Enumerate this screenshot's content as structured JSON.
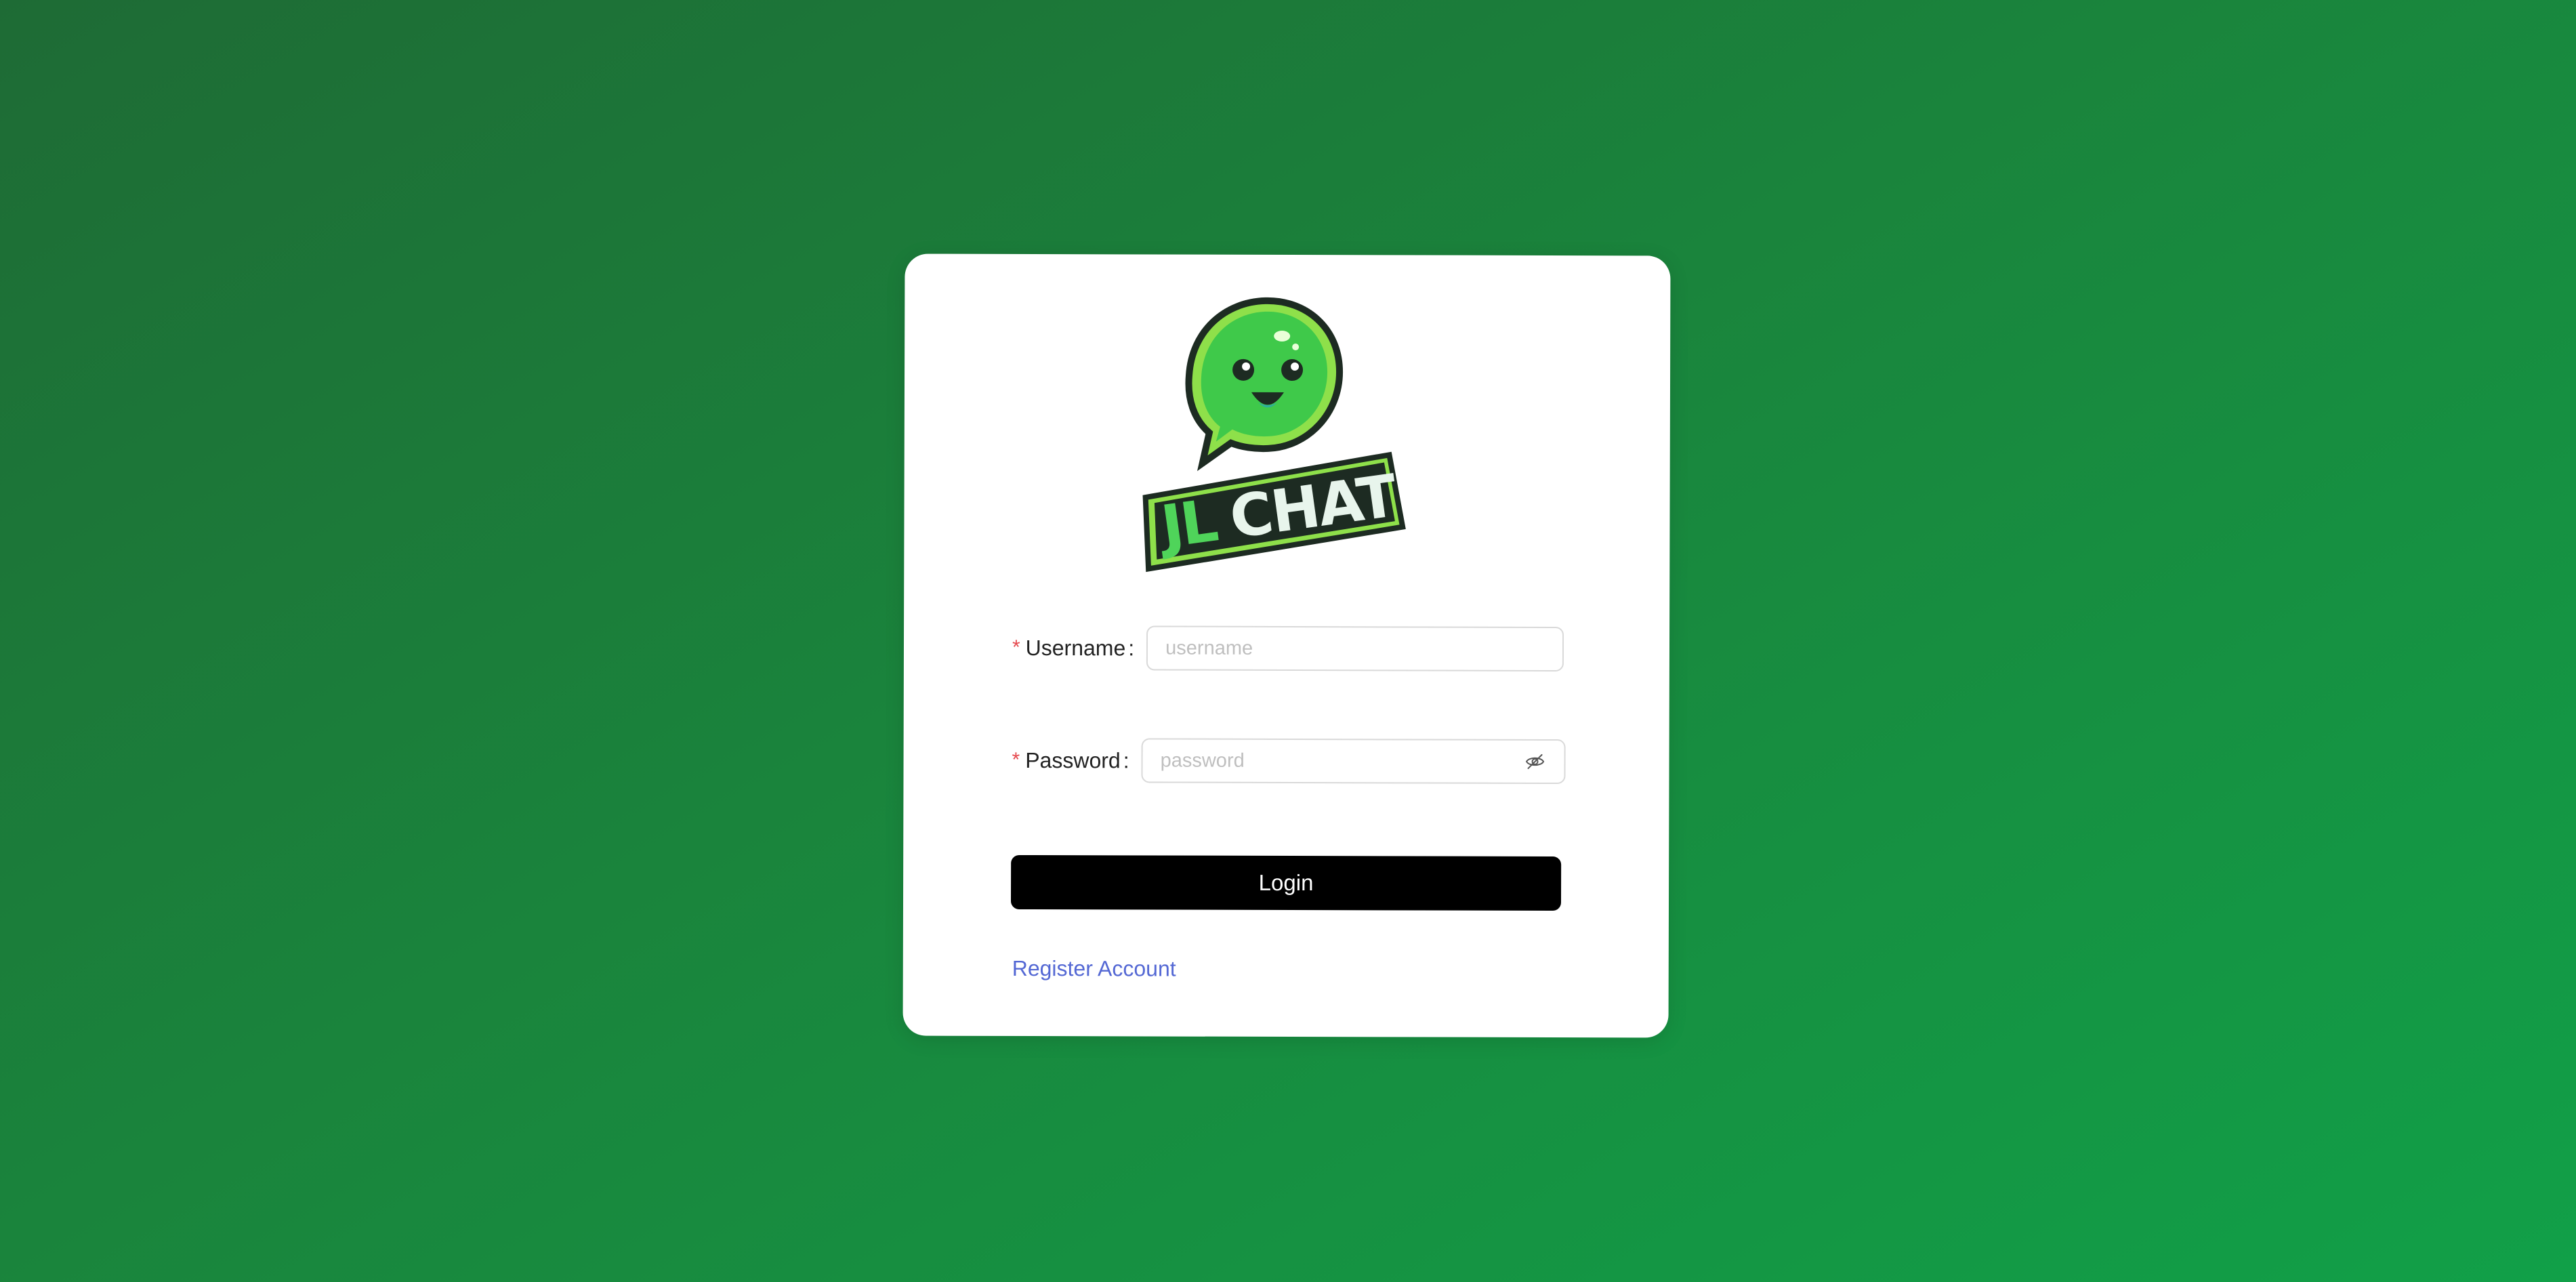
{
  "logo": {
    "text": "JLCHAT",
    "icon": "chat-bubble-smiley-logo"
  },
  "form": {
    "username": {
      "label": "Username",
      "placeholder": "username",
      "required_mark": "*"
    },
    "password": {
      "label": "Password",
      "placeholder": "password",
      "required_mark": "*",
      "toggle_icon": "eye-slash-icon"
    },
    "colon": ":"
  },
  "actions": {
    "login_label": "Login",
    "register_label": "Register Account"
  },
  "colors": {
    "background_start": "#1e6b35",
    "background_end": "#11a048",
    "button": "#000000",
    "link": "#5468d4",
    "required": "#e5484d"
  }
}
